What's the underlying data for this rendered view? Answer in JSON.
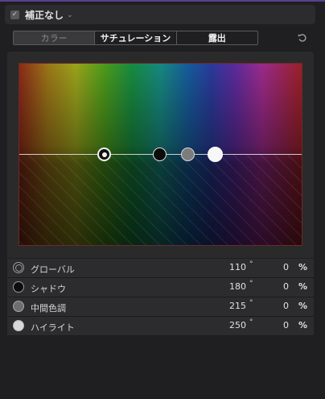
{
  "header": {
    "checkbox_checked": true,
    "checkbox_glyph": "✓",
    "title": "補正なし",
    "chevron": "⌄"
  },
  "tabs": [
    {
      "label": "カラー",
      "active": false
    },
    {
      "label": "サチュレーション",
      "active": true
    },
    {
      "label": "露出",
      "active": true
    }
  ],
  "reset_icon": "reset-icon",
  "board": {
    "pucks": [
      {
        "name": "global",
        "angle": 110
      },
      {
        "name": "shadow",
        "angle": 180
      },
      {
        "name": "midtones",
        "angle": 215
      },
      {
        "name": "highlights",
        "angle": 250
      }
    ]
  },
  "rows": [
    {
      "icon": "global-icon",
      "label": "グローバル",
      "angle": "110",
      "deg": "°",
      "value": "0",
      "unit": "%"
    },
    {
      "icon": "shadow-icon",
      "label": "シャドウ",
      "angle": "180",
      "deg": "°",
      "value": "0",
      "unit": "%"
    },
    {
      "icon": "midtones-icon",
      "label": "中間色調",
      "angle": "215",
      "deg": "°",
      "value": "0",
      "unit": "%"
    },
    {
      "icon": "highlights-icon",
      "label": "ハイライト",
      "angle": "250",
      "deg": "°",
      "value": "0",
      "unit": "%"
    }
  ],
  "colors": {
    "accent_line": "#5b3f8e",
    "board_border": "#6a2a2a",
    "panel_bg": "#1f1f21"
  }
}
